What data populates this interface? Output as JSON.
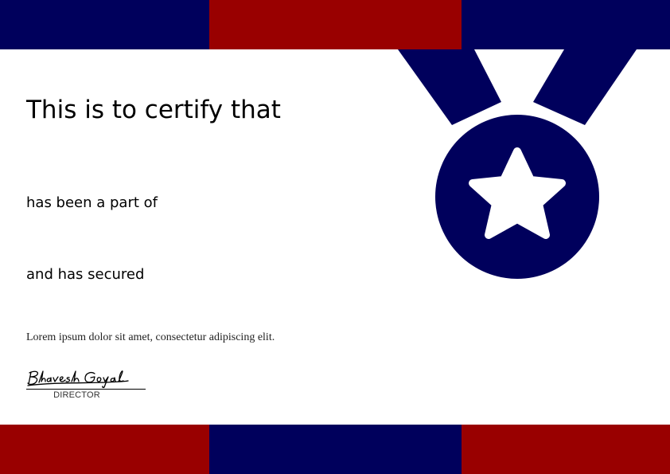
{
  "colors": {
    "navy": "#00005c",
    "red": "#990000",
    "background": "#ffffff"
  },
  "certificate": {
    "heading": "This is to certify that",
    "line_part_of": "has been a part of",
    "line_secured": "and has secured",
    "description": "Lorem ipsum dolor sit amet, consectetur adipiscing elit.",
    "signatory_title": "DIRECTOR",
    "signature_text": "Bhavesh Goyal"
  },
  "icons": {
    "emblem": "medal-star-icon"
  }
}
